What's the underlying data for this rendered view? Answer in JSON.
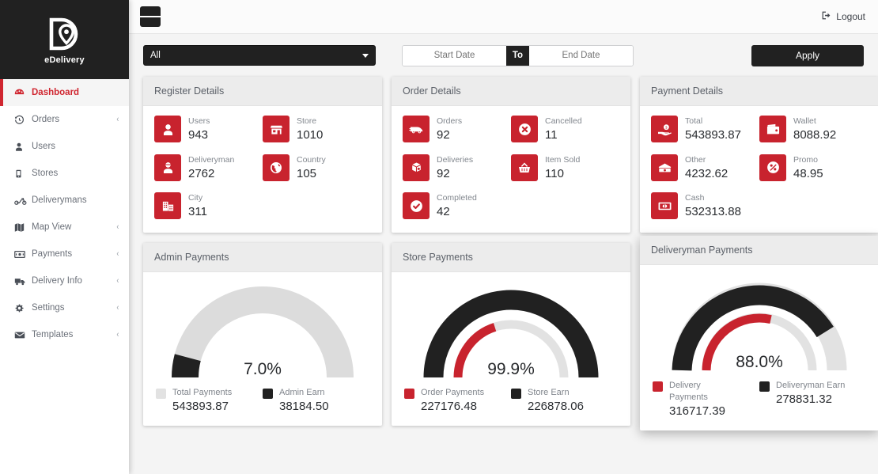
{
  "brand": {
    "name": "eDelivery",
    "logo_icon": "delivery-pin-logo"
  },
  "sidebar": {
    "items": [
      {
        "label": "Dashboard",
        "icon": "dashboard-icon",
        "active": true,
        "caret": false
      },
      {
        "label": "Orders",
        "icon": "history-icon",
        "active": false,
        "caret": true
      },
      {
        "label": "Users",
        "icon": "user-icon",
        "active": false,
        "caret": false
      },
      {
        "label": "Stores",
        "icon": "store-icon",
        "active": false,
        "caret": false
      },
      {
        "label": "Deliverymans",
        "icon": "motorbike-icon",
        "active": false,
        "caret": false
      },
      {
        "label": "Map View",
        "icon": "map-icon",
        "active": false,
        "caret": true
      },
      {
        "label": "Payments",
        "icon": "money-icon",
        "active": false,
        "caret": true
      },
      {
        "label": "Delivery Info",
        "icon": "truck-icon",
        "active": false,
        "caret": true
      },
      {
        "label": "Settings",
        "icon": "gear-icon",
        "active": false,
        "caret": true
      },
      {
        "label": "Templates",
        "icon": "envelope-icon",
        "active": false,
        "caret": true
      }
    ],
    "caret_glyph": "‹"
  },
  "topbar": {
    "menu_icon": "hamburger-icon",
    "logout_label": "Logout",
    "logout_icon": "logout-icon"
  },
  "filterbar": {
    "select_value": "All",
    "select_options": [
      "All"
    ],
    "start_placeholder": "Start Date",
    "start_value": "",
    "end_placeholder": "End Date",
    "end_value": "",
    "separator_label": "To",
    "apply_label": "Apply"
  },
  "colors": {
    "accent_red": "#c8232e",
    "dark": "#212121",
    "track_grey": "#d9d9d9"
  },
  "cards": {
    "register": {
      "title": "Register Details",
      "stats": [
        {
          "label": "Users",
          "value": "943",
          "icon": "user-card-icon"
        },
        {
          "label": "Store",
          "value": "1010",
          "icon": "store-card-icon"
        },
        {
          "label": "Deliveryman",
          "value": "2762",
          "icon": "deliveryman-card-icon"
        },
        {
          "label": "Country",
          "value": "105",
          "icon": "globe-card-icon"
        },
        {
          "label": "City",
          "value": "311",
          "icon": "city-card-icon"
        }
      ]
    },
    "order": {
      "title": "Order Details",
      "stats": [
        {
          "label": "Orders",
          "value": "92",
          "icon": "van-card-icon"
        },
        {
          "label": "Cancelled",
          "value": "11",
          "icon": "cancel-card-icon"
        },
        {
          "label": "Deliveries",
          "value": "92",
          "icon": "parcel-card-icon"
        },
        {
          "label": "Item Sold",
          "value": "110",
          "icon": "basket-card-icon"
        },
        {
          "label": "Completed",
          "value": "42",
          "icon": "check-card-icon"
        }
      ]
    },
    "payment": {
      "title": "Payment Details",
      "stats": [
        {
          "label": "Total",
          "value": "543893.87",
          "icon": "hand-coin-card-icon"
        },
        {
          "label": "Wallet",
          "value": "8088.92",
          "icon": "wallet-card-icon"
        },
        {
          "label": "Other",
          "value": "4232.62",
          "icon": "money-bill-card-icon"
        },
        {
          "label": "Promo",
          "value": "48.95",
          "icon": "percent-card-icon"
        },
        {
          "label": "Cash",
          "value": "532313.88",
          "icon": "cash-card-icon"
        }
      ]
    }
  },
  "chart_data": [
    {
      "type": "pie",
      "chart_style": "half-donut-gauge",
      "title": "Admin Payments",
      "center_label": "7.0%",
      "rings": [
        {
          "name": "Total Payments",
          "percent": 100,
          "color": "#dcdcdc",
          "radius": "outer"
        },
        {
          "name": "Admin Earn",
          "percent": 7,
          "color": "#212121",
          "radius": "outer-overlay"
        }
      ],
      "legend_position": "bottom",
      "series": [
        {
          "name": "Total Payments",
          "value": 543893.87,
          "display": "543893.87",
          "color": "#dcdcdc"
        },
        {
          "name": "Admin Earn",
          "value": 38184.5,
          "display": "38184.50",
          "color": "#212121"
        }
      ]
    },
    {
      "type": "pie",
      "chart_style": "half-donut-gauge",
      "title": "Store Payments",
      "center_label": "99.9%",
      "rings": [
        {
          "name": "Store Earn",
          "percent": 100,
          "color": "#212121",
          "radius": "outer"
        },
        {
          "name": "Order Payments",
          "percent": 40,
          "color": "#c8232e",
          "radius": "inner",
          "track_color": "#e2e2e2"
        }
      ],
      "legend_position": "bottom",
      "series": [
        {
          "name": "Order Payments",
          "value": 227176.48,
          "display": "227176.48",
          "color": "#c8232e"
        },
        {
          "name": "Store Earn",
          "value": 226878.06,
          "display": "226878.06",
          "color": "#212121"
        }
      ]
    },
    {
      "type": "pie",
      "chart_style": "half-donut-gauge",
      "title": "Deliveryman Payments",
      "center_label": "88.0%",
      "rings": [
        {
          "name": "Deliveryman Earn",
          "percent": 88,
          "color": "#212121",
          "radius": "outer",
          "track_color": "#e2e2e2"
        },
        {
          "name": "Delivery Payments",
          "percent": 57,
          "color": "#c8232e",
          "radius": "inner",
          "track_color": "#e2e2e2"
        }
      ],
      "legend_position": "bottom",
      "series": [
        {
          "name": "Delivery Payments",
          "value": 316717.39,
          "display": "316717.39",
          "color": "#c8232e"
        },
        {
          "name": "Deliveryman Earn",
          "value": 278831.32,
          "display": "278831.32",
          "color": "#212121"
        }
      ]
    }
  ]
}
